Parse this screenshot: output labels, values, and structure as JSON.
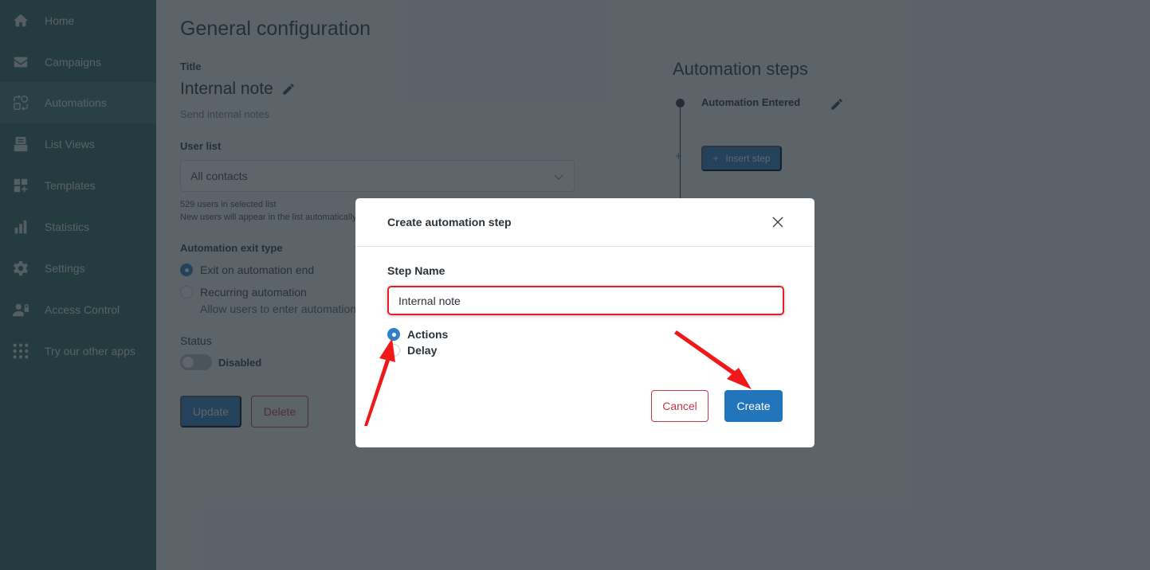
{
  "sidebar": {
    "items": [
      {
        "label": "Home",
        "icon": "home-icon",
        "active": false
      },
      {
        "label": "Campaigns",
        "icon": "mail-icon",
        "active": false
      },
      {
        "label": "Automations",
        "icon": "automations-icon",
        "active": true
      },
      {
        "label": "List Views",
        "icon": "list-views-icon",
        "active": false
      },
      {
        "label": "Templates",
        "icon": "templates-icon",
        "active": false
      },
      {
        "label": "Statistics",
        "icon": "bar-chart-icon",
        "active": false
      },
      {
        "label": "Settings",
        "icon": "gear-icon",
        "active": false
      },
      {
        "label": "Access Control",
        "icon": "user-lock-icon",
        "active": false
      },
      {
        "label": "Try our other apps",
        "icon": "apps-grid-icon",
        "active": false
      }
    ]
  },
  "config": {
    "page_title": "General configuration",
    "title_label": "Title",
    "title_value": "Internal note",
    "title_description": "Send internal notes",
    "user_list_label": "User list",
    "user_list_value": "All contacts",
    "user_count_text": "529 users in selected list",
    "user_list_note": "New users will appear in the list automatically",
    "exit_type_label": "Automation exit type",
    "exit_options": [
      {
        "label": "Exit on automation end",
        "selected": true
      },
      {
        "label": "Recurring automation",
        "selected": false,
        "description": "Allow users to enter automation multiple times"
      }
    ],
    "status_label": "Status",
    "status_value": "Disabled",
    "status_enabled": false,
    "update_label": "Update",
    "delete_label": "Delete"
  },
  "steps": {
    "title": "Automation steps",
    "items": [
      {
        "name": "Automation Entered"
      }
    ],
    "insert_label": "Insert step"
  },
  "modal": {
    "title": "Create automation step",
    "step_name_label": "Step Name",
    "step_name_value": "Internal note",
    "type_options": [
      {
        "label": "Actions",
        "selected": true
      },
      {
        "label": "Delay",
        "selected": false
      }
    ],
    "cancel_label": "Cancel",
    "create_label": "Create"
  },
  "colors": {
    "sidebar": "#2e6b63",
    "primary": "#2275bb",
    "danger": "#c0394a",
    "annotation": "#e61e2a"
  }
}
